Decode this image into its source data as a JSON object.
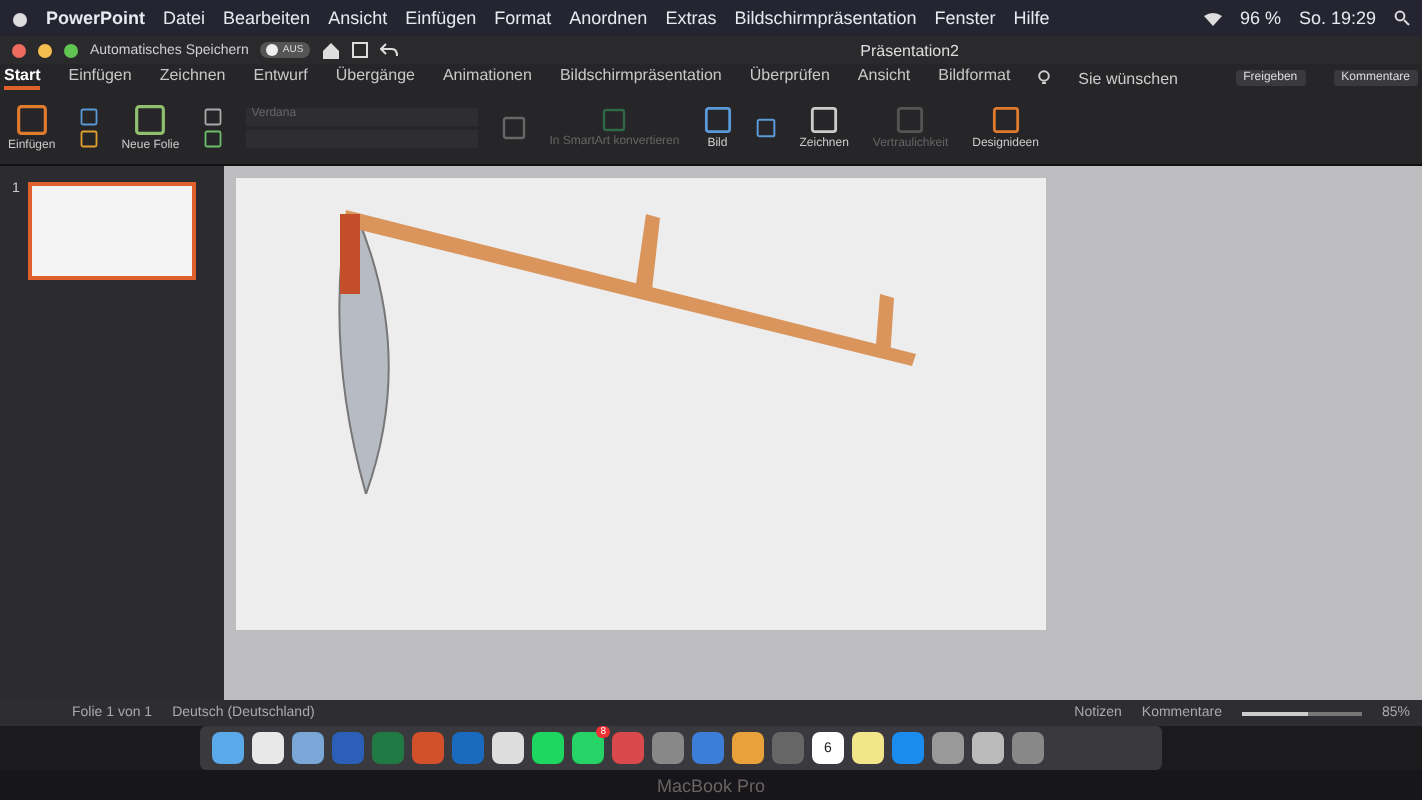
{
  "menu_bar": {
    "app": "PowerPoint",
    "items": [
      "Datei",
      "Bearbeiten",
      "Ansicht",
      "Einfügen",
      "Format",
      "Anordnen",
      "Extras",
      "Bildschirmpräsentation",
      "Fenster",
      "Hilfe"
    ],
    "battery": "96 %",
    "clock": "So. 19:29"
  },
  "title_bar": {
    "autosave": "Automatisches Speichern",
    "autosave_toggle": {
      "label": "AUS",
      "on": false
    },
    "title": "Präsentation2"
  },
  "tabs": [
    {
      "label": "Start",
      "selected": true
    },
    {
      "label": "Einfügen",
      "selected": false
    },
    {
      "label": "Zeichnen",
      "selected": false
    },
    {
      "label": "Entwurf",
      "selected": false
    },
    {
      "label": "Übergänge",
      "selected": false
    },
    {
      "label": "Animationen",
      "selected": false
    },
    {
      "label": "Bildschirmpräsentation",
      "selected": false
    },
    {
      "label": "Überprüfen",
      "selected": false
    },
    {
      "label": "Ansicht",
      "selected": false
    },
    {
      "label": "Bildformat",
      "selected": false
    }
  ],
  "tell_me": "Sie wünschen",
  "share_button": "Freigeben",
  "comments_button": "Kommentare",
  "ribbon": {
    "paste": "Einfügen",
    "new_slide": "Neue Folie",
    "font": "Verdana",
    "smartart": "In SmartArt konvertieren",
    "picture": "Bild",
    "draw": "Zeichnen",
    "sensitivity": "Vertraulichkeit",
    "designer": "Designideen"
  },
  "slides": [
    {
      "number": "1",
      "selected": true
    }
  ],
  "status_bar": {
    "slide_count": "Folie 1 von 1",
    "language": "Deutsch (Deutschland)",
    "notes": "Notizen",
    "comments": "Kommentare",
    "zoom": {
      "level": 0.55,
      "reading": "85%"
    }
  },
  "dock": {
    "badge": "8",
    "calendar_day": "6"
  },
  "bezel": "MacBook Pro"
}
